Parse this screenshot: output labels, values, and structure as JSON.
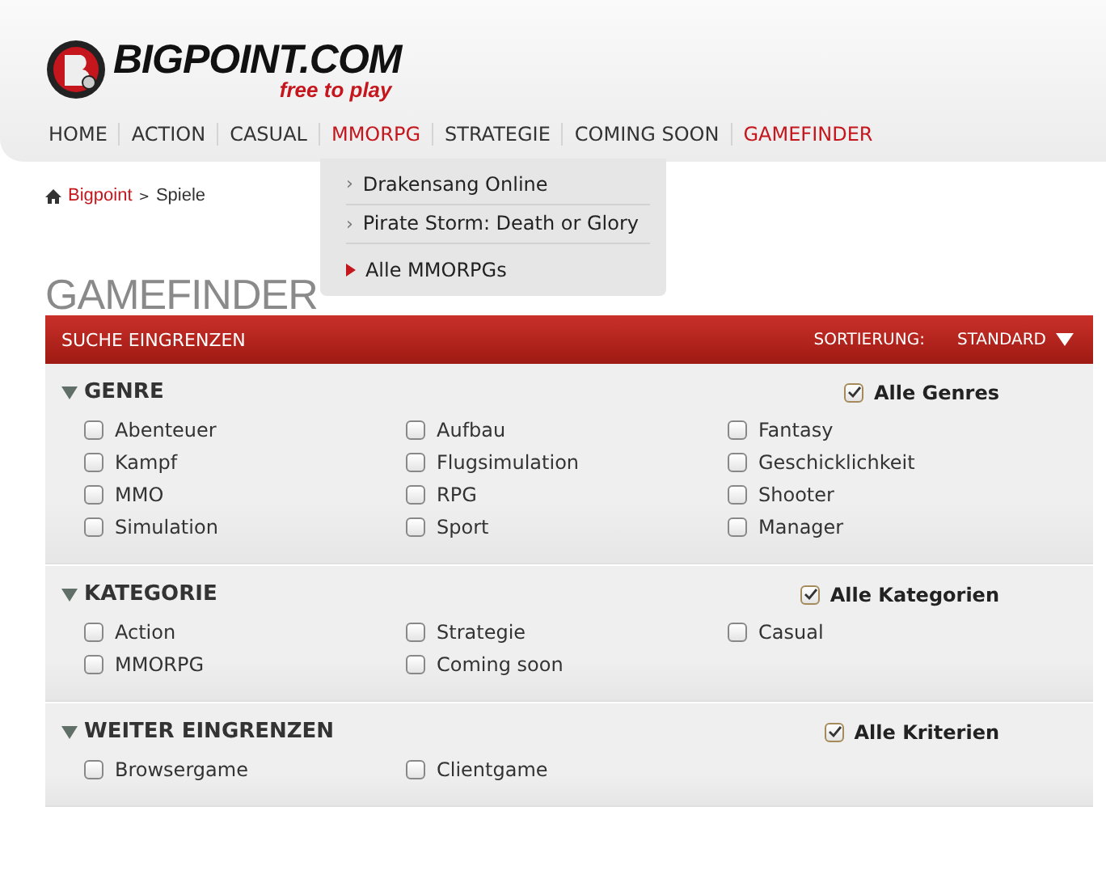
{
  "logo": {
    "name": "BIGPOINT.COM",
    "tagline": "free to play"
  },
  "nav": [
    {
      "label": "HOME",
      "highlighted": false
    },
    {
      "label": "ACTION",
      "highlighted": false
    },
    {
      "label": "CASUAL",
      "highlighted": false
    },
    {
      "label": "MMORPG",
      "highlighted": true,
      "dropdown": [
        {
          "kind": "game",
          "marker": "›",
          "label": "Drakensang Online"
        },
        {
          "kind": "game",
          "marker": "›",
          "label": "Pirate Storm: Death or Glory"
        },
        {
          "kind": "all",
          "label": "Alle MMORPGs"
        }
      ]
    },
    {
      "label": "STRATEGIE",
      "highlighted": false
    },
    {
      "label": "COMING SOON",
      "highlighted": false
    },
    {
      "label": "GAMEFINDER",
      "highlighted": true
    }
  ],
  "breadcrumb": [
    {
      "label": "Bigpoint",
      "kind": "link"
    },
    {
      "label": "Spiele",
      "kind": "current"
    }
  ],
  "breadcrumb_separator": ">",
  "page_title": "GAMEFINDER",
  "filter_bar": {
    "title": "SUCHE EINGRENZEN",
    "sort_label": "SORTIERUNG:",
    "sort_value": "STANDARD"
  },
  "sections": [
    {
      "title": "GENRE",
      "expanded": true,
      "all": {
        "label": "Alle Genres",
        "checked": true
      },
      "options": [
        {
          "label": "Abenteuer",
          "checked": false
        },
        {
          "label": "Aufbau",
          "checked": false
        },
        {
          "label": "Fantasy",
          "checked": false
        },
        {
          "label": "Kampf",
          "checked": false
        },
        {
          "label": "Flugsimulation",
          "checked": false
        },
        {
          "label": "Geschicklichkeit",
          "checked": false
        },
        {
          "label": "MMO",
          "checked": false
        },
        {
          "label": "RPG",
          "checked": false
        },
        {
          "label": "Shooter",
          "checked": false
        },
        {
          "label": "Simulation",
          "checked": false
        },
        {
          "label": "Sport",
          "checked": false
        },
        {
          "label": "Manager",
          "checked": false
        }
      ]
    },
    {
      "title": "KATEGORIE",
      "expanded": true,
      "all": {
        "label": "Alle Kategorien",
        "checked": true
      },
      "options": [
        {
          "label": "Action",
          "checked": false
        },
        {
          "label": "Strategie",
          "checked": false
        },
        {
          "label": "Casual",
          "checked": false
        },
        {
          "label": "MMORPG",
          "checked": false
        },
        {
          "label": "Coming soon",
          "checked": false
        }
      ]
    },
    {
      "title": "WEITER EINGRENZEN",
      "expanded": true,
      "all": {
        "label": "Alle Kriterien",
        "checked": true
      },
      "options": [
        {
          "label": "Browsergame",
          "checked": false
        },
        {
          "label": "Clientgame",
          "checked": false
        }
      ]
    }
  ]
}
